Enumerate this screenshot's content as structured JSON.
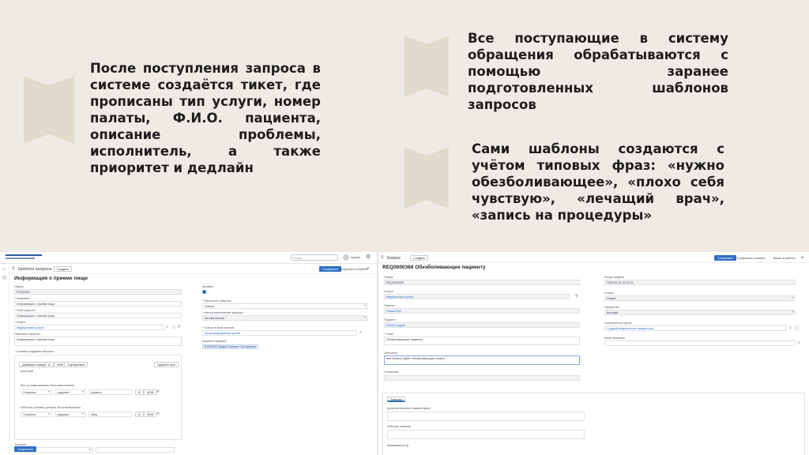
{
  "slide": {
    "text1": "После поступления запроса в системе создаётся тикет, где прописаны тип услуги, номер палаты, Ф.И.О. пациента, описание проблемы, исполнитель, а также приоритет и дедлайн",
    "text2": "Все поступающие в систему обращения обрабатываются с помощью заранее подготовленных шаблонов запросов",
    "text3": "Сами шаблоны создаются с учётом типовых фраз: «нужно обезболивающее», «плохо себя чувствую», «лечащий врач», «запись на процедуры»"
  },
  "left_screen": {
    "search_placeholder": "Поиск",
    "user_label": "Админ",
    "breadcrumb": "Шаблон запроса",
    "create_button": "Создать",
    "save_button": "Сохранить",
    "save_exit_link": "Сохранить и выйти",
    "form_title": "Информация о приеме пищи",
    "number_label": "Номер",
    "number_value": "RT000002",
    "name_label": "* Название",
    "name_value": "Информация о приеме пищи",
    "subject_label": "* Тема запроса",
    "subject_value": "Информация о приеме пищи",
    "service_label": "* Услуга",
    "service_value": "Медицинская услуга",
    "desc_label": "Описание запроса",
    "desc_value": "Информация о приеме пищи",
    "conditions_label": "* Условия создания запроса",
    "cond_add_label": "Добавить новый",
    "cond_and": "И",
    "cond_or": "ИЛИ",
    "cond_sort": "Сортировка",
    "cond_remove": "Удалить все",
    "cond_phrase": "критерий",
    "cond_group1": "Все условия должны быть выполнены",
    "cond_group2": "ИЛИ все условия должны быть выполнены",
    "row1": [
      "Описание",
      "содержит",
      "кормить"
    ],
    "row2": [
      "Описание",
      "содержит",
      "обед"
    ],
    "template_label": "Template",
    "bottom_save": "Сохранить",
    "active_label": "Активно",
    "priority_label": "* Приоритет запроса",
    "priority_value": "Низкий",
    "method_label": "* Метод выполнения запроса",
    "method_value": "Автоматически",
    "group_label": "* Статус в базе знаний",
    "group_value": "Актуализированная группа",
    "kb_label": "Базовое правило",
    "kb_value": "RT000002 Задача Питание Тип правила"
  },
  "right_screen": {
    "breadcrumb": "Запрос",
    "create_button": "Создать",
    "save_button": "Сохранить",
    "save_exit_link": "Сохранить и выйти",
    "to_work_link": "Взять в работу",
    "form_title": "REQ0000368 Обезболивающее пациенту",
    "number_label": "Номер",
    "number_value": "REQ0000368",
    "service_label": "Услуга",
    "service_value": "Медицинская услуга",
    "ward_label": "Палата",
    "ward_value": "Палата 541",
    "patient_label": "Пациент",
    "patient_value": "Юлия Гладкая",
    "subject_label": "* Тема",
    "subject_value": "Обезболивающее пациенту",
    "desc_label": "Описание",
    "desc_value": "мне больно! Дайте обезболивающее скорее",
    "clarify_label": "Уточнение",
    "created_label": "Когда создано",
    "created_value": "2020-05-20 16:10:33",
    "status_label": "Статус",
    "status_value": "Новый",
    "priority_label": "Приоритет",
    "priority_value": "Высокий",
    "assignee_label": "Назначен на группу",
    "assignee_value": "Средний медперсонал (медсестра)",
    "person_label": "Кому назначен",
    "tab_label": "Заметки",
    "extra_label": "Дополнительные комментарии",
    "work_label": "Рабочие заметки",
    "auto_label": "Автовывести ф."
  }
}
